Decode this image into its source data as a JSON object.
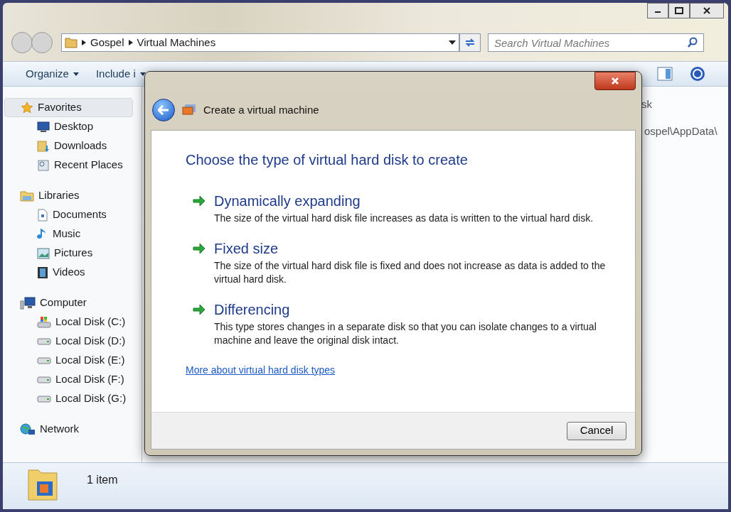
{
  "address_bar": {
    "crumbs": [
      "Gospel",
      "Virtual Machines"
    ]
  },
  "search": {
    "placeholder": "Search Virtual Machines"
  },
  "toolbar": {
    "items": [
      "Organize",
      "Include i"
    ]
  },
  "sidebar": {
    "groups": [
      {
        "label": "Favorites",
        "selected": true,
        "children": [
          {
            "label": "Desktop"
          },
          {
            "label": "Downloads"
          },
          {
            "label": "Recent Places"
          }
        ]
      },
      {
        "label": "Libraries",
        "selected": false,
        "children": [
          {
            "label": "Documents"
          },
          {
            "label": "Music"
          },
          {
            "label": "Pictures"
          },
          {
            "label": "Videos"
          }
        ]
      },
      {
        "label": "Computer",
        "selected": false,
        "children": [
          {
            "label": "Local Disk (C:)"
          },
          {
            "label": "Local Disk (D:)"
          },
          {
            "label": "Local Disk (E:)"
          },
          {
            "label": "Local Disk (F:)"
          },
          {
            "label": "Local Disk (G:)"
          }
        ]
      },
      {
        "label": "Network",
        "selected": false
      }
    ]
  },
  "content": {
    "column_fragment": "sk",
    "path_fragment": "ospel\\AppData\\"
  },
  "status_bar": {
    "count": "1 item"
  },
  "dialog": {
    "title": "Create a virtual machine",
    "heading": "Choose the type of virtual hard disk to create",
    "options": [
      {
        "title": "Dynamically expanding",
        "description": "The size of the virtual hard disk file increases as data is written to the virtual hard disk."
      },
      {
        "title": "Fixed size",
        "description": "The size of the virtual hard disk file is fixed and does not increase as data is added to the virtual hard disk."
      },
      {
        "title": "Differencing",
        "description": "This type stores changes in a separate disk so that you can isolate changes to a virtual machine and leave the original disk intact."
      }
    ],
    "link": "More about virtual hard disk types",
    "cancel": "Cancel"
  }
}
